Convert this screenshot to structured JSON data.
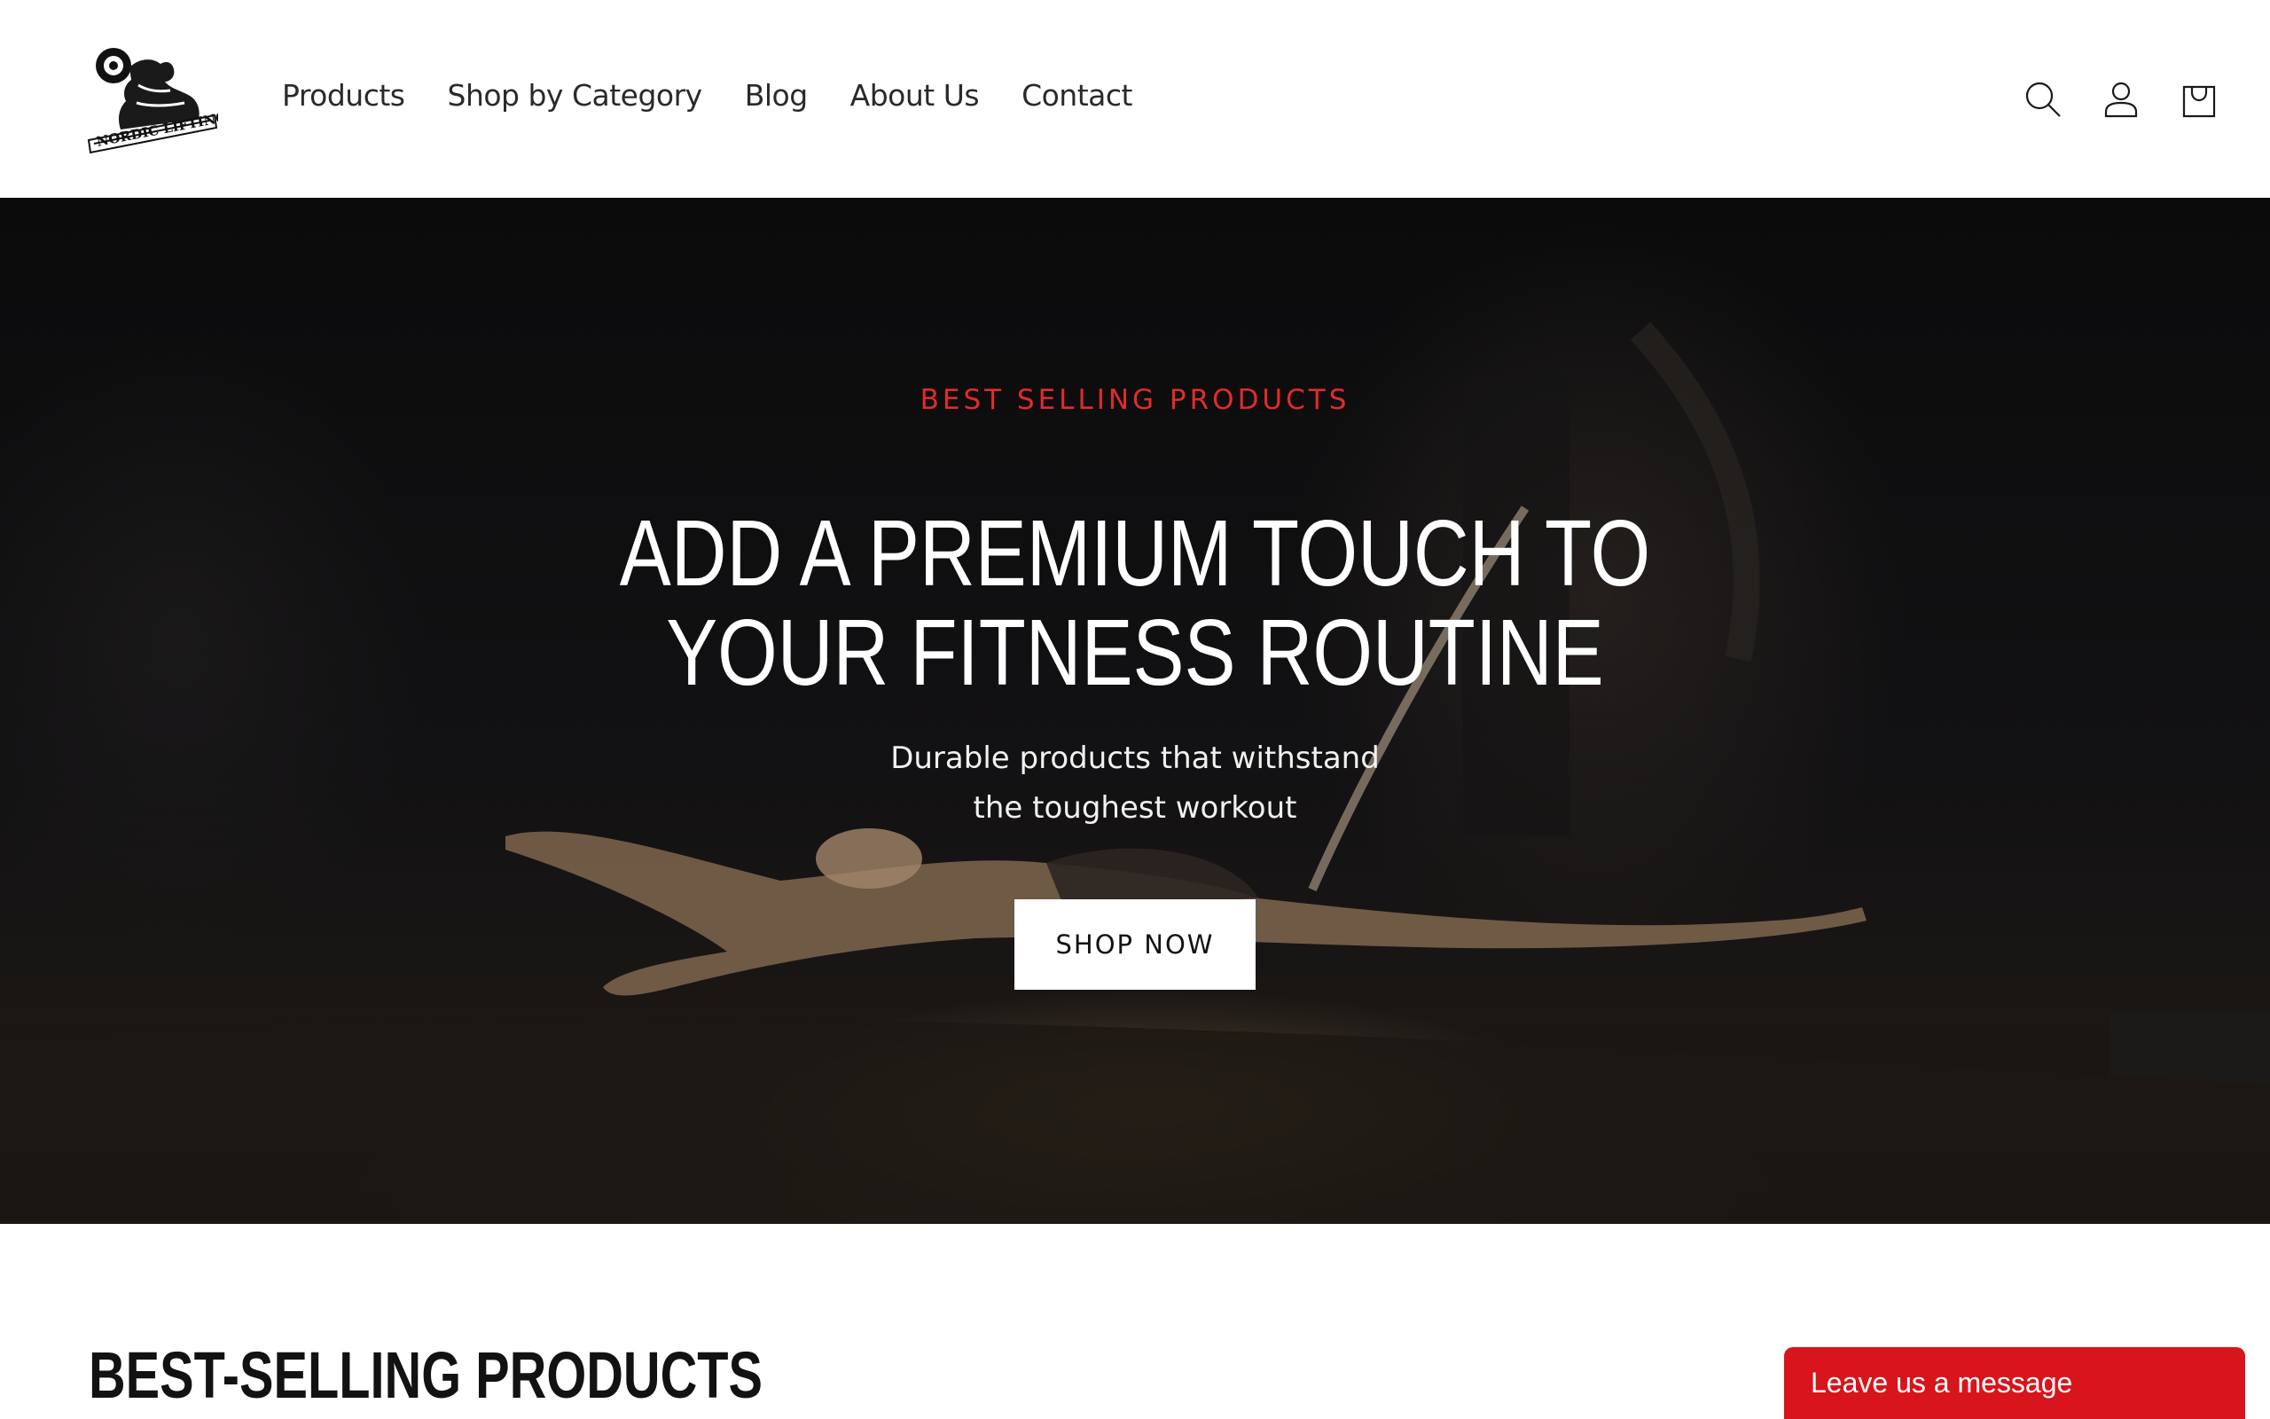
{
  "brand": {
    "logo_text": "NORDIC LIFTING"
  },
  "nav": {
    "items": [
      {
        "label": "Products"
      },
      {
        "label": "Shop by Category"
      },
      {
        "label": "Blog"
      },
      {
        "label": "About Us"
      },
      {
        "label": "Contact"
      }
    ]
  },
  "header_icons": {
    "search": "search-icon",
    "account": "account-icon",
    "cart": "cart-icon"
  },
  "hero": {
    "eyebrow": "BEST SELLING PRODUCTS",
    "title_line1": "ADD A PREMIUM TOUCH TO",
    "title_line2": "YOUR FITNESS ROUTINE",
    "subtitle_line1": "Durable products that withstand",
    "subtitle_line2": "the toughest workout",
    "button_label": "SHOP NOW",
    "eyebrow_color": "#e32a2a"
  },
  "section": {
    "title": "BEST-SELLING PRODUCTS"
  },
  "chat": {
    "label": "Leave us a message",
    "color": "#d8141c"
  }
}
